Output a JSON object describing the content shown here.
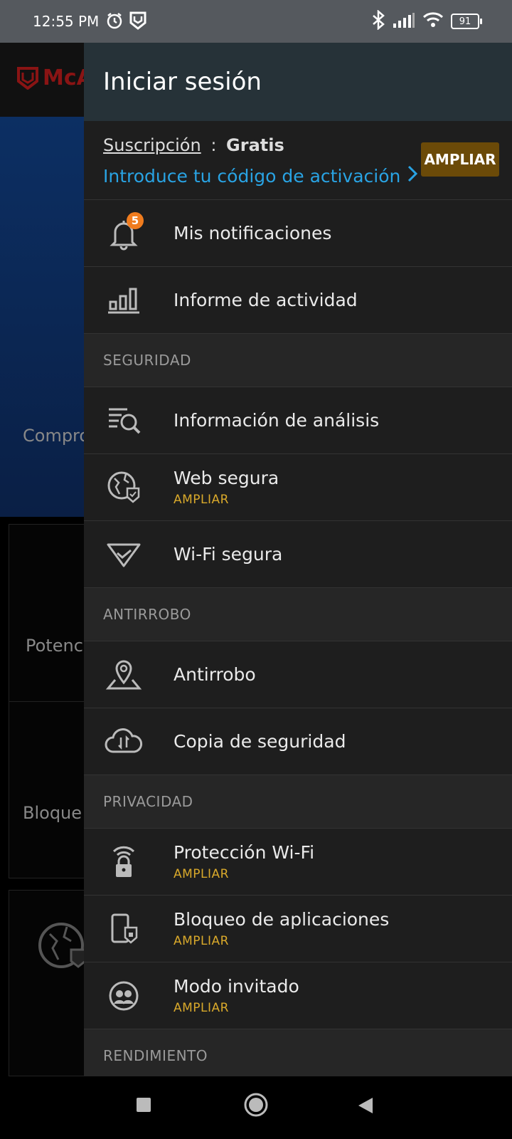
{
  "status_bar": {
    "time": "12:55 PM",
    "battery": "91",
    "icons": [
      "alarm-icon",
      "mcafee-shield-icon",
      "bluetooth-icon",
      "signal-icon",
      "wifi-icon",
      "battery-icon"
    ]
  },
  "background": {
    "logo_text": "McA",
    "hero_text": "Compro",
    "card_text_1": "Potenc",
    "card_text_2": "Bloque"
  },
  "drawer": {
    "header_title": "Iniciar sesión",
    "subscription": {
      "label": "Suscripción",
      "separator": ":",
      "value": "Gratis",
      "activation_link": "Introduce tu código de activación",
      "upgrade_button": "AMPLIAR"
    },
    "items_top": [
      {
        "label": "Mis notificaciones",
        "icon": "bell-icon",
        "badge": "5"
      },
      {
        "label": "Informe de actividad",
        "icon": "bar-chart-icon"
      }
    ],
    "sections": [
      {
        "title": "SEGURIDAD",
        "items": [
          {
            "label": "Información de análisis",
            "icon": "scan-list-icon",
            "sub": ""
          },
          {
            "label": "Web segura",
            "icon": "globe-shield-icon",
            "sub": "AMPLIAR"
          },
          {
            "label": "Wi-Fi segura",
            "icon": "wifi-check-icon",
            "sub": ""
          }
        ]
      },
      {
        "title": "ANTIRROBO",
        "items": [
          {
            "label": "Antirrobo",
            "icon": "location-pin-icon",
            "sub": ""
          },
          {
            "label": "Copia de seguridad",
            "icon": "cloud-sync-icon",
            "sub": ""
          }
        ]
      },
      {
        "title": "PRIVACIDAD",
        "items": [
          {
            "label": "Protección Wi-Fi",
            "icon": "wifi-lock-icon",
            "sub": "AMPLIAR"
          },
          {
            "label": "Bloqueo de aplicaciones",
            "icon": "app-lock-icon",
            "sub": "AMPLIAR"
          },
          {
            "label": "Modo invitado",
            "icon": "guest-icon",
            "sub": "AMPLIAR"
          }
        ]
      },
      {
        "title": "RENDIMIENTO",
        "items": []
      }
    ]
  },
  "colors": {
    "drawer_header": "#263238",
    "link": "#29a3e3",
    "upgrade_button": "#6b4a08",
    "upgrade_text": "#d9a92b",
    "badge": "#f07c1e"
  }
}
